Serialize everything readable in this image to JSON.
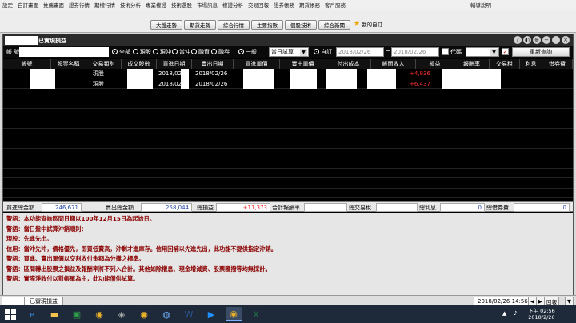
{
  "menu": [
    "設定",
    "自訂畫面",
    "推薦畫面",
    "證券行情",
    "期權行情",
    "技術分析",
    "專業權證",
    "技術選股",
    "市場訊息",
    "權證分析",
    "交易回報",
    "證券帳務",
    "期貨帳務",
    "客戶服務",
    "",
    "輔導說明"
  ],
  "toolbar": {
    "buttons": [
      "大盤走勢",
      "期貨走勢",
      "綜合行情",
      "主要指數",
      "個股技術",
      "綜合新聞"
    ],
    "star_label": "我的自訂"
  },
  "window": {
    "title": "已實現損益",
    "controls": [
      "?",
      "◐",
      "⊕",
      "−",
      "□",
      "×"
    ]
  },
  "filter": {
    "account_label": "帳 號",
    "radios": [
      {
        "label": "全部",
        "on": true
      },
      {
        "label": "現股",
        "on": false
      },
      {
        "label": "現沖",
        "on": false
      },
      {
        "label": "當沖",
        "on": false
      },
      {
        "label": "融資",
        "on": false
      },
      {
        "label": "融券",
        "on": false
      },
      {
        "label": "一般",
        "on": true
      }
    ],
    "query_select": "當日試算",
    "custom_radio": "自訂",
    "date_from": "2018/02/26",
    "date_sep": "~",
    "date_to": "2018/02/26",
    "code_label": "代碼",
    "checked": "✓",
    "refresh_button": "重新查詢"
  },
  "columns": [
    "帳號",
    "股票名稱",
    "交易類別",
    "成交股數",
    "買進日期",
    "賣出日期",
    "買進單價",
    "賣出單價",
    "付出成本",
    "帳面收入",
    "損益",
    "報酬率",
    "交易稅",
    "利息",
    "借券費"
  ],
  "rows": [
    {
      "type": "現股",
      "buy_date": "2018/02/",
      "sell_date": "2018/02/26",
      "pnl": "+4,936"
    },
    {
      "type": "現股",
      "buy_date": "2018/02/",
      "sell_date": "2018/02/26",
      "pnl": "+6,437"
    }
  ],
  "summary": {
    "buy_total_label": "買進總金額",
    "buy_total": "246,671",
    "sell_total_label": "賣出總金額",
    "sell_total": "258,044",
    "pnl_label": "總損益",
    "pnl_total": "+11,373",
    "return_label": "合計報酬率",
    "tax_label": "總交易稅",
    "interest_label": "總利息",
    "interest_total": "0",
    "lend_label": "總借券費",
    "lend_total": "0"
  },
  "notes": [
    "警語：本功能查詢區間日期以100年12月15日為起始日。",
    "警語：當日盤中試算沖銷順則：",
    "現股：先進先出。",
    "信用：當沖先沖，價格優先，即買低賣高，沖剩才進庫存。信用回補以先進先出，此功能不提供指定沖銷。",
    "警語：買進、賣出單價以交割收付金額為分攤之標準。",
    "警語：區間轉出股票之損益及報酬率將不列入合計。其他如除權息、現金增減資、股票匯撥等均無採計。",
    "警語：實際淨收付以對帳單為主，此功能僅供試算。"
  ],
  "statusbar": {
    "tab": "已實現損益",
    "clock": "2018/02/26 14:56:33",
    "btns": [
      "◀",
      "▶",
      "回報"
    ],
    "extra": "▼"
  },
  "taskbar": {
    "time": "下午 02:56",
    "date": "2018/2/26",
    "icons": [
      "ie-icon",
      "folder-icon",
      "store-icon",
      "chrome-icon",
      "explorer-icon",
      "chrome-icon",
      "globe-icon",
      "word-icon",
      "media-icon",
      "chrome-icon",
      "excel-icon"
    ]
  }
}
